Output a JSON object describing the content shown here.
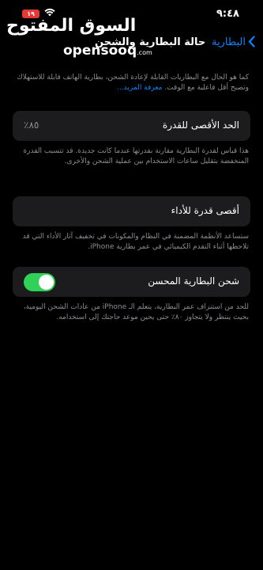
{
  "status_bar": {
    "time": "٩:٤٨",
    "battery_level": "١٩"
  },
  "watermark": {
    "arabic": "السوق المفتوح",
    "latin": "opensooq",
    "suffix": ".com"
  },
  "nav": {
    "back_label": "البطارية",
    "title": "حالة البطارية والشحن"
  },
  "intro": {
    "text": "كما هو الحال مع البطاريات القابلة لإعادة الشحن، بطارية الهاتف قابلة للاستهلاك وتصبح أقل فاعلية مع الوقت.",
    "link": "معرفة المزيد..."
  },
  "max_capacity": {
    "label": "الحد الأقصى للقدرة",
    "value": "٪٨٥",
    "note": "هذا قياس لقدرة البطارية مقارنة بقدرتها عندما كانت جديدة. قد تتسبب القدرة المنخفضة بتقليل ساعات الاستخدام بين عملية الشحن والأخرى."
  },
  "peak_performance": {
    "label": "أقصى قدرة للأداء",
    "note": "ستساعد الأنظمة المضمنة في النظام والمكونات في تخفيف آثار الأداء التي قد تلاحظها أثناء التقدم الكيميائي في عمر بطارية iPhone."
  },
  "optimized_charging": {
    "label": "شحن البطارية المحسن",
    "enabled": true,
    "note": "للحد من استنزاف عمر البطارية، يتعلم الـ iPhone من عادات الشحن اليومية، بحيث ينتظر ولا يتجاوز ٨٠٪ حتى يحين موعد حاجتك إلى استخدامه."
  },
  "colors": {
    "accent": "#0a84ff",
    "toggle_on": "#30d158",
    "cell_bg": "#1c1c1e",
    "secondary_text": "#8e8e93",
    "battery_low": "#e53935"
  },
  "icons": {
    "back": "chevron-left-icon",
    "wifi": "wifi-icon",
    "battery": "battery-icon"
  }
}
